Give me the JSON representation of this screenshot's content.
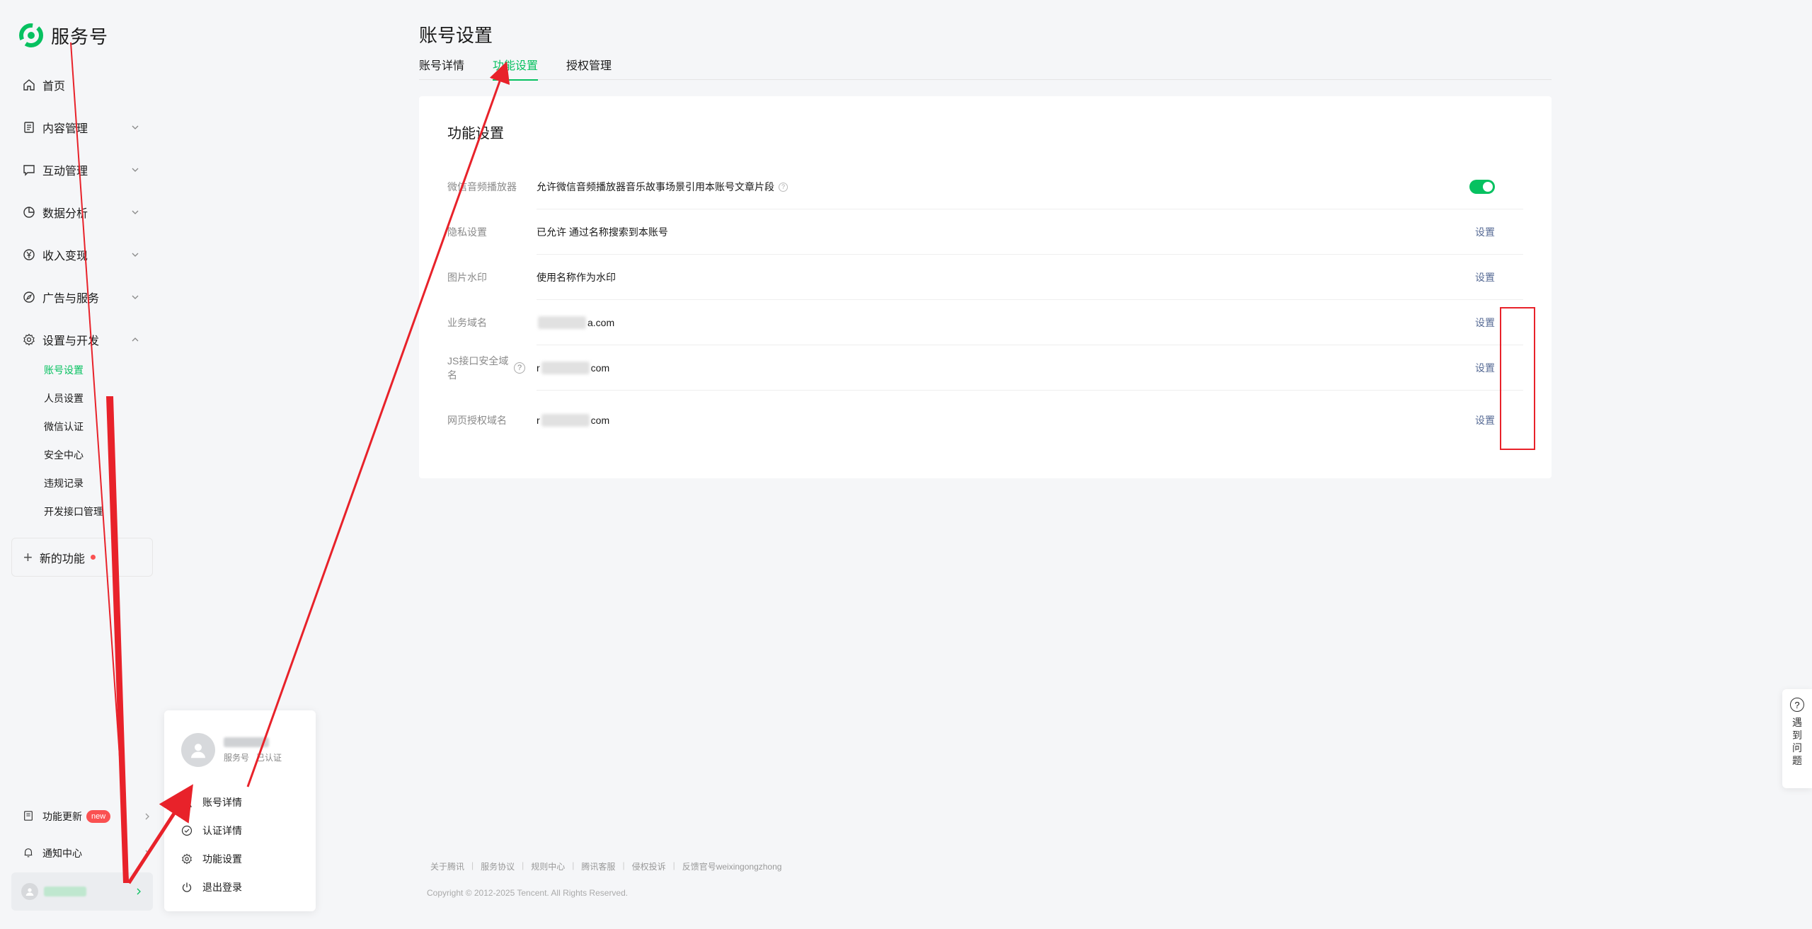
{
  "app": {
    "brand": "服务号",
    "brand_color": "#07c160"
  },
  "sidebar": {
    "items": [
      {
        "label": "首页",
        "icon": "home-icon"
      },
      {
        "label": "内容管理",
        "icon": "document-icon"
      },
      {
        "label": "互动管理",
        "icon": "chat-icon"
      },
      {
        "label": "数据分析",
        "icon": "pie-chart-icon"
      },
      {
        "label": "收入变现",
        "icon": "yen-icon"
      },
      {
        "label": "广告与服务",
        "icon": "compass-icon"
      },
      {
        "label": "设置与开发",
        "icon": "gear-icon"
      }
    ],
    "sub_items": [
      "账号设置",
      "人员设置",
      "微信认证",
      "安全中心",
      "违规记录",
      "开发接口管理"
    ],
    "new_feature": "新的功能",
    "updates": {
      "label": "功能更新",
      "badge": "new"
    },
    "notifications": "通知中心"
  },
  "popover": {
    "account_type": "服务号",
    "verified": "已认证",
    "menu": [
      {
        "label": "账号详情",
        "icon": "person-icon"
      },
      {
        "label": "认证详情",
        "icon": "check-circle-icon"
      },
      {
        "label": "功能设置",
        "icon": "gear-icon"
      },
      {
        "label": "退出登录",
        "icon": "power-icon"
      }
    ]
  },
  "main": {
    "title": "账号设置",
    "tabs": [
      "账号详情",
      "功能设置",
      "授权管理"
    ],
    "active_tab": "功能设置",
    "card_title": "功能设置",
    "rows": [
      {
        "label": "微信音频播放器",
        "value": "允许微信音频播放器音乐故事场景引用本账号文章片段",
        "action": "",
        "toggle": true
      },
      {
        "label": "隐私设置",
        "value": "已允许 通过名称搜索到本账号",
        "action": "设置"
      },
      {
        "label": "图片水印",
        "value": "使用名称作为水印",
        "action": "设置"
      },
      {
        "label": "业务域名",
        "value_prefix": "",
        "value_suffix": "a.com",
        "action": "设置"
      },
      {
        "label": "JS接口安全域名",
        "value_prefix": "r",
        "value_suffix": "com",
        "action": "设置"
      },
      {
        "label": "网页授权域名",
        "value_prefix": "r",
        "value_suffix": "com",
        "action": "设置"
      }
    ]
  },
  "footer": {
    "links": [
      "关于腾讯",
      "服务协议",
      "规则中心",
      "腾讯客服",
      "侵权投诉",
      "反馈官号weixingongzhong"
    ],
    "copyright": "Copyright © 2012-2025 Tencent. All Rights Reserved."
  },
  "help": {
    "label": "遇到问题"
  },
  "annotation_color": "#e8222a"
}
